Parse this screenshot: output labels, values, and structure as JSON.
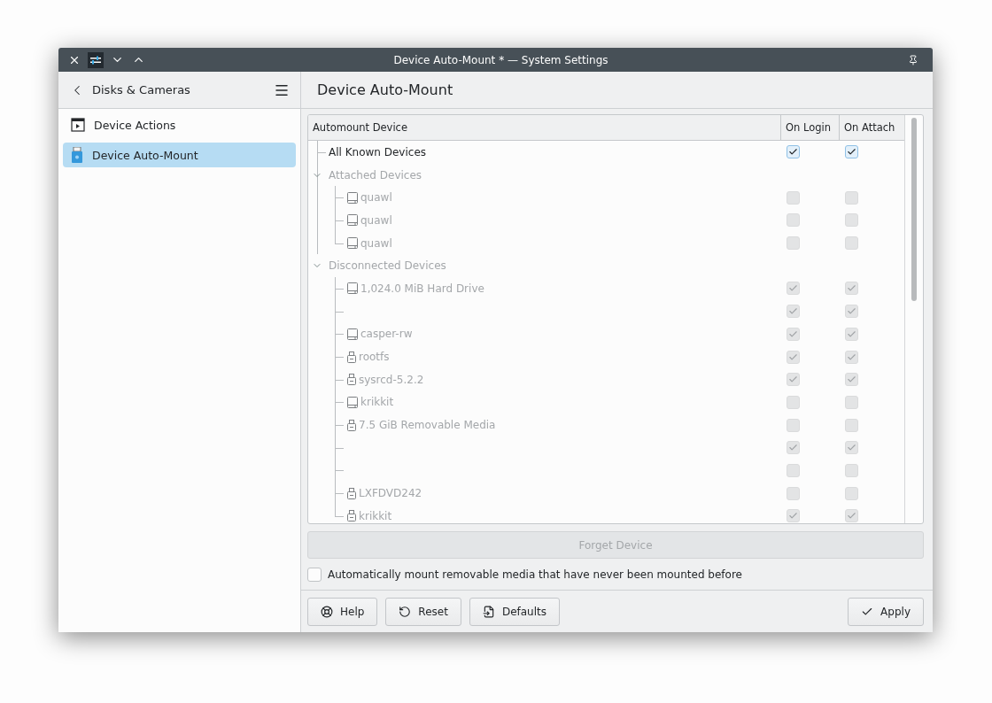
{
  "window": {
    "title": "Device Auto-Mount * — System Settings"
  },
  "sidebar": {
    "back_label": "Disks & Cameras",
    "items": [
      {
        "label": "Device Actions",
        "kind": "actions",
        "selected": false
      },
      {
        "label": "Device Auto-Mount",
        "kind": "automount",
        "selected": true
      }
    ]
  },
  "page": {
    "title": "Device Auto-Mount"
  },
  "table": {
    "columns": [
      "Automount Device",
      "On Login",
      "On Attach"
    ],
    "tree": [
      {
        "name": "All Known Devices",
        "kind": "none",
        "disabled": false,
        "on_login": true,
        "on_attach": true
      },
      {
        "name": "Attached Devices",
        "kind": "group",
        "disabled": true,
        "expanded": true,
        "children": [
          {
            "name": "quawl",
            "kind": "disk",
            "disabled": true,
            "on_login": false,
            "on_attach": false
          },
          {
            "name": "quawl",
            "kind": "disk",
            "disabled": true,
            "on_login": false,
            "on_attach": false
          },
          {
            "name": "quawl",
            "kind": "disk",
            "disabled": true,
            "on_login": false,
            "on_attach": false
          }
        ]
      },
      {
        "name": "Disconnected Devices",
        "kind": "group",
        "disabled": true,
        "expanded": true,
        "children": [
          {
            "name": "1,024.0 MiB Hard Drive",
            "kind": "disk",
            "disabled": true,
            "on_login": true,
            "on_attach": true
          },
          {
            "kind": "none",
            "disabled": true,
            "on_login": true,
            "on_attach": true
          },
          {
            "name": "casper-rw",
            "kind": "disk",
            "disabled": true,
            "on_login": true,
            "on_attach": true
          },
          {
            "name": "rootfs",
            "kind": "usb",
            "disabled": true,
            "on_login": true,
            "on_attach": true
          },
          {
            "name": "sysrcd-5.2.2",
            "kind": "usb",
            "disabled": true,
            "on_login": true,
            "on_attach": true
          },
          {
            "name": "krikkit",
            "kind": "disk",
            "disabled": true,
            "on_login": false,
            "on_attach": false
          },
          {
            "name": "7.5 GiB Removable Media",
            "kind": "usb",
            "disabled": true,
            "on_login": false,
            "on_attach": false
          },
          {
            "kind": "none",
            "disabled": true,
            "on_login": true,
            "on_attach": true
          },
          {
            "kind": "none",
            "disabled": true,
            "on_login": false,
            "on_attach": false
          },
          {
            "name": "LXFDVD242",
            "kind": "usb",
            "disabled": true,
            "on_login": false,
            "on_attach": false
          },
          {
            "name": "krikkit",
            "kind": "usb",
            "disabled": true,
            "on_login": true,
            "on_attach": true
          }
        ]
      }
    ]
  },
  "forget_button": {
    "label": "Forget Device",
    "disabled": true
  },
  "auto_mount_option": {
    "label": "Automatically mount removable media that have never been mounted before",
    "checked": false
  },
  "footer_buttons": [
    {
      "label": "Help",
      "kind": "help"
    },
    {
      "label": "Reset",
      "kind": "reset"
    },
    {
      "label": "Defaults",
      "kind": "defaults"
    },
    {
      "label": "Apply",
      "kind": "apply"
    }
  ]
}
